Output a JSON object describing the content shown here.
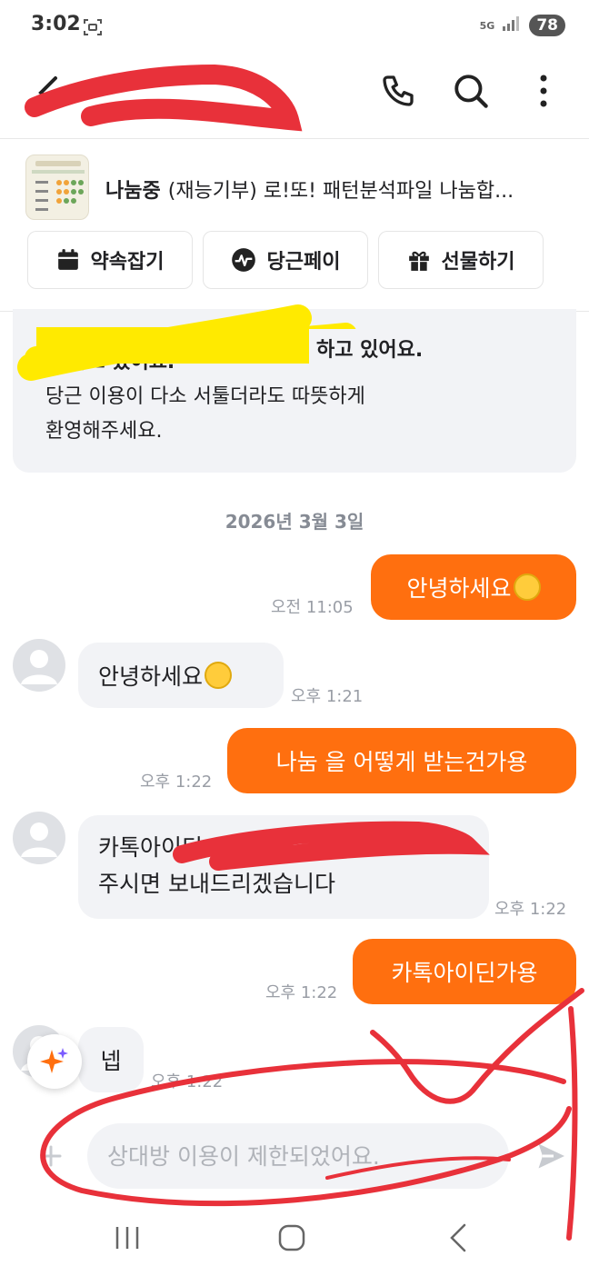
{
  "status_bar": {
    "time": "3:02",
    "network": "5G",
    "battery": "78"
  },
  "header": {
    "title": ""
  },
  "product": {
    "status": "나눔중",
    "title": "(재능기부) 로!또! 패턴분석파일 나눔합..."
  },
  "actions": [
    {
      "label": "약속잡기",
      "icon": "calendar-icon"
    },
    {
      "label": "당근페이",
      "icon": "pay-icon"
    },
    {
      "label": "선물하기",
      "icon": "gift-icon"
    }
  ],
  "notice": {
    "line1": "...하고 있어요.",
    "line2": "당근 이용이 다소 서툴더라도 따뜻하게",
    "line3": "환영해주세요."
  },
  "date_separator": "2026년 3월 3일",
  "messages": [
    {
      "dir": "out",
      "text": "안녕하세요",
      "emoji": "smiling-face-icon",
      "time": "오전 11:05"
    },
    {
      "dir": "in",
      "text": "안녕하세요",
      "emoji": "smiling-face-icon",
      "time": "오후 1:21"
    },
    {
      "dir": "out",
      "text": "나눔 을 어떻게 받는건가용",
      "time": "오후 1:22"
    },
    {
      "dir": "in",
      "line1": "카톡아이디...",
      "line2": "주시면 보내드리겠습니다",
      "time": "오후 1:22"
    },
    {
      "dir": "out",
      "text": "카톡아이딘가용",
      "time": "오후 1:22"
    },
    {
      "dir": "in",
      "text": "넵",
      "time": "오후 1:22"
    }
  ],
  "input": {
    "placeholder": "상대방 이용이 제한되었어요."
  },
  "colors": {
    "accent": "#ff6f0f",
    "bubble_in": "#f2f3f6",
    "redaction_red": "#e8313a",
    "redaction_yellow": "#ffea00"
  }
}
